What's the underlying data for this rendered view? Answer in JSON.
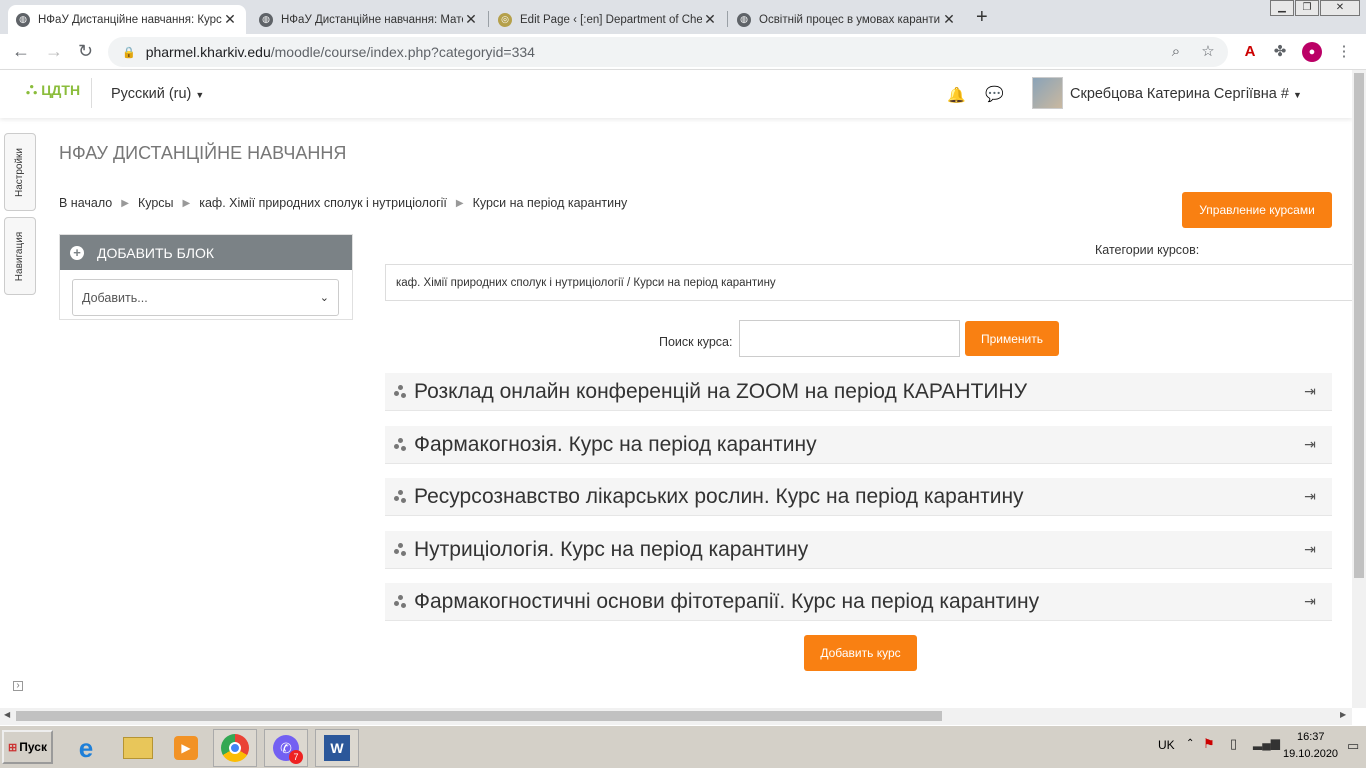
{
  "browser": {
    "tabs": [
      {
        "title": "НФаУ Дистанційне навчання: Курс",
        "active": true
      },
      {
        "title": "НФаУ Дистанційне навчання: Мате",
        "active": false
      },
      {
        "title": "Edit Page ‹ [:en] Department of Che",
        "active": false
      },
      {
        "title": "Освітній процес в умовах каранти",
        "active": false
      }
    ],
    "new_tab": "+",
    "url_host": "pharmel.kharkiv.edu",
    "url_path": "/moodle/course/index.php?categoryid=334"
  },
  "header": {
    "logo": "ЦДТН",
    "language": "Русский (ru)",
    "user_name": "Скребцова Катерина Сергіївна #"
  },
  "drawers": {
    "settings": "Настройки",
    "navigation": "Навигация"
  },
  "page": {
    "title": "НФАУ ДИСТАНЦІЙНЕ НАВЧАННЯ",
    "breadcrumb": [
      "В начало",
      "Курсы",
      "каф. Хімії природних сполук і нутриціології",
      "Курси на період карантину"
    ],
    "manage_courses": "Управление курсами",
    "categories_label": "Категории курсов:",
    "category_select": "каф. Хімії природних сполук і нутриціології / Курси на період карантину",
    "search_label": "Поиск курса:",
    "search_value": "",
    "apply": "Применить",
    "courses": [
      "Розклад онлайн конференцій на ZOOM на період КАРАНТИНУ",
      "Фармакогнозія. Курс на період карантину",
      "Ресурсознавство лікарських рослин. Курс на період карантину",
      "Нутриціологія. Курс на період карантину",
      "Фармакогностичні основи фітотерапії. Курс на період карантину"
    ],
    "add_course": "Добавить курс"
  },
  "block": {
    "title": "ДОБАВИТЬ БЛОК",
    "select_value": "Добавить..."
  },
  "taskbar": {
    "start": "Пуск",
    "viber_badge": "7",
    "lang": "UK",
    "time": "16:37",
    "date": "19.10.2020"
  },
  "colors": {
    "accent": "#f98012",
    "block_header": "#7b8286",
    "tabbar": "#dee1e6",
    "taskbar": "#d4d0c8"
  }
}
